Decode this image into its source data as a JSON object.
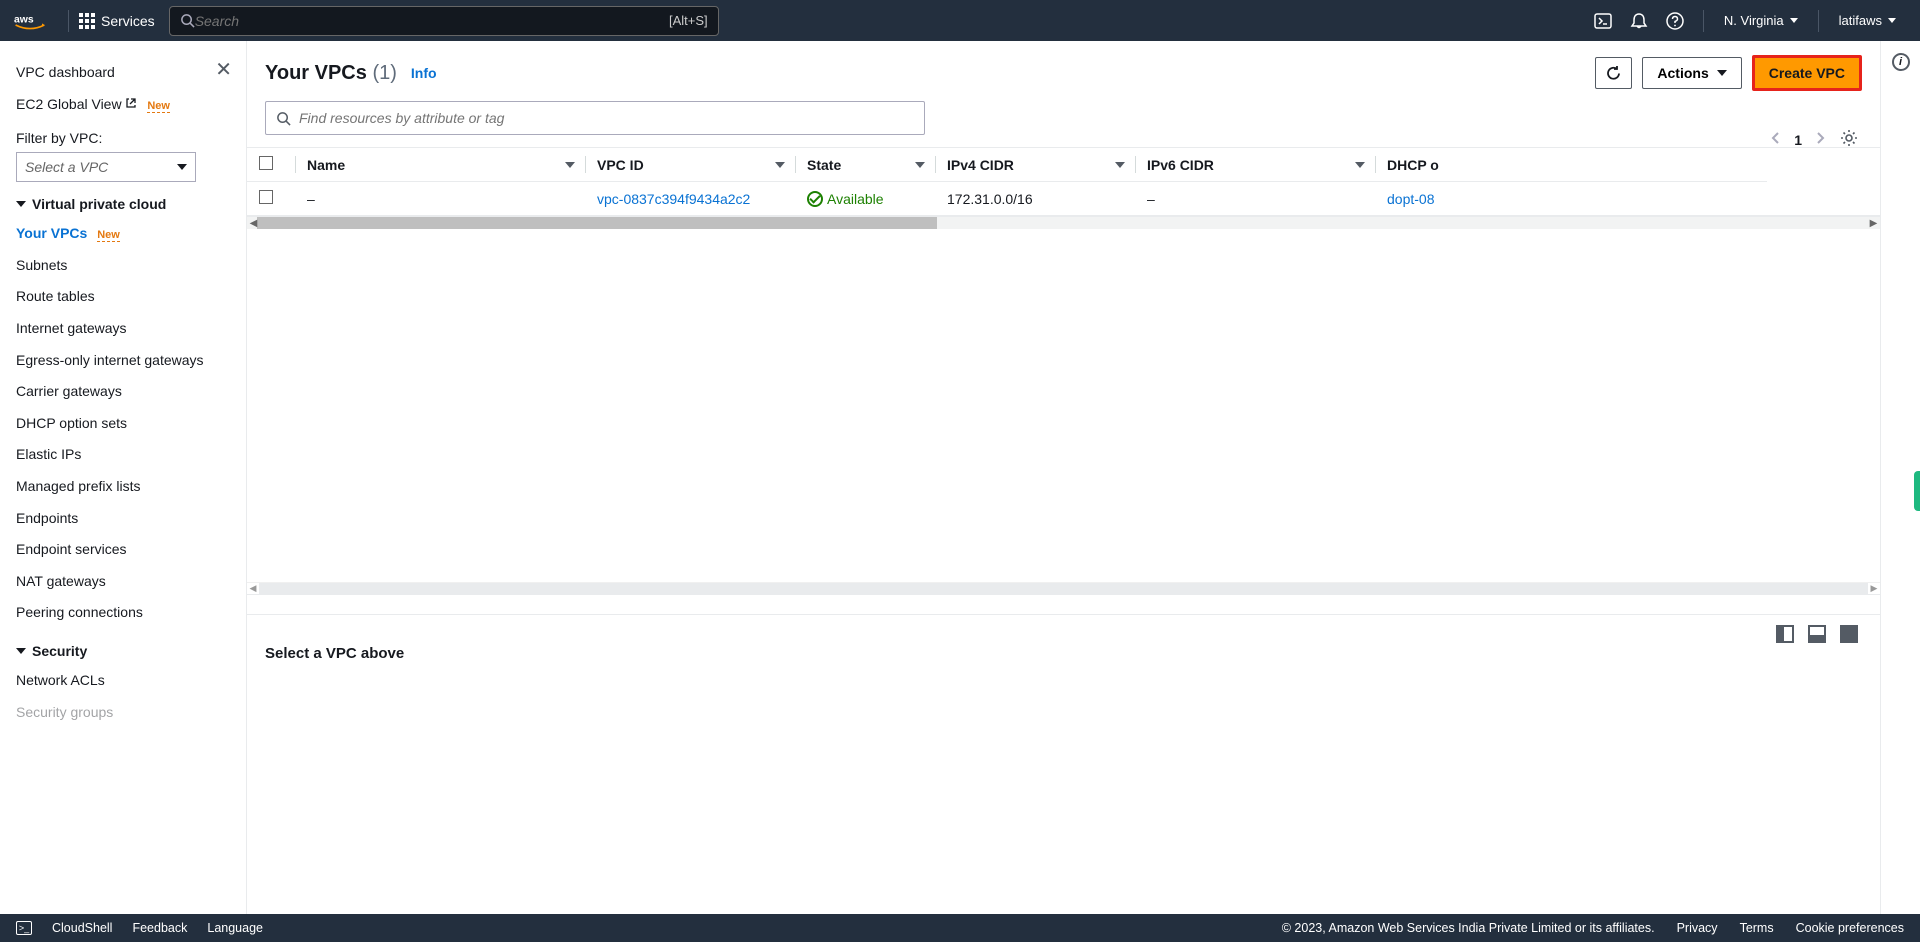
{
  "topnav": {
    "services_label": "Services",
    "search_placeholder": "Search",
    "search_kbd": "[Alt+S]",
    "region": "N. Virginia",
    "user": "latifaws"
  },
  "sidebar": {
    "dashboard": "VPC dashboard",
    "ec2_global": "EC2 Global View",
    "ec2_new": "New",
    "filter_label": "Filter by VPC:",
    "filter_placeholder": "Select a VPC",
    "sections": {
      "vpc": {
        "title": "Virtual private cloud",
        "items": [
          {
            "label": "Your VPCs",
            "new": "New",
            "active": true
          },
          {
            "label": "Subnets"
          },
          {
            "label": "Route tables"
          },
          {
            "label": "Internet gateways"
          },
          {
            "label": "Egress-only internet gateways"
          },
          {
            "label": "Carrier gateways"
          },
          {
            "label": "DHCP option sets"
          },
          {
            "label": "Elastic IPs"
          },
          {
            "label": "Managed prefix lists"
          },
          {
            "label": "Endpoints"
          },
          {
            "label": "Endpoint services"
          },
          {
            "label": "NAT gateways"
          },
          {
            "label": "Peering connections"
          }
        ]
      },
      "security": {
        "title": "Security",
        "items": [
          {
            "label": "Network ACLs"
          },
          {
            "label": "Security groups"
          }
        ]
      }
    }
  },
  "main": {
    "title": "Your VPCs",
    "count": "(1)",
    "info": "Info",
    "actions": {
      "refresh": "Refresh",
      "actions_label": "Actions",
      "create": "Create VPC"
    },
    "filter_placeholder": "Find resources by attribute or tag",
    "pager": {
      "page": "1"
    },
    "columns": {
      "name": "Name",
      "vpc_id": "VPC ID",
      "state": "State",
      "ipv4": "IPv4 CIDR",
      "ipv6": "IPv6 CIDR",
      "dhcp": "DHCP o"
    },
    "rows": [
      {
        "name": "–",
        "vpc_id": "vpc-0837c394f9434a2c2",
        "state": "Available",
        "ipv4": "172.31.0.0/16",
        "ipv6": "–",
        "dhcp": "dopt-08"
      }
    ],
    "detail_empty": "Select a VPC above"
  },
  "footer": {
    "cloudshell": "CloudShell",
    "feedback": "Feedback",
    "language": "Language",
    "copyright": "© 2023, Amazon Web Services India Private Limited or its affiliates.",
    "privacy": "Privacy",
    "terms": "Terms",
    "cookies": "Cookie preferences"
  }
}
